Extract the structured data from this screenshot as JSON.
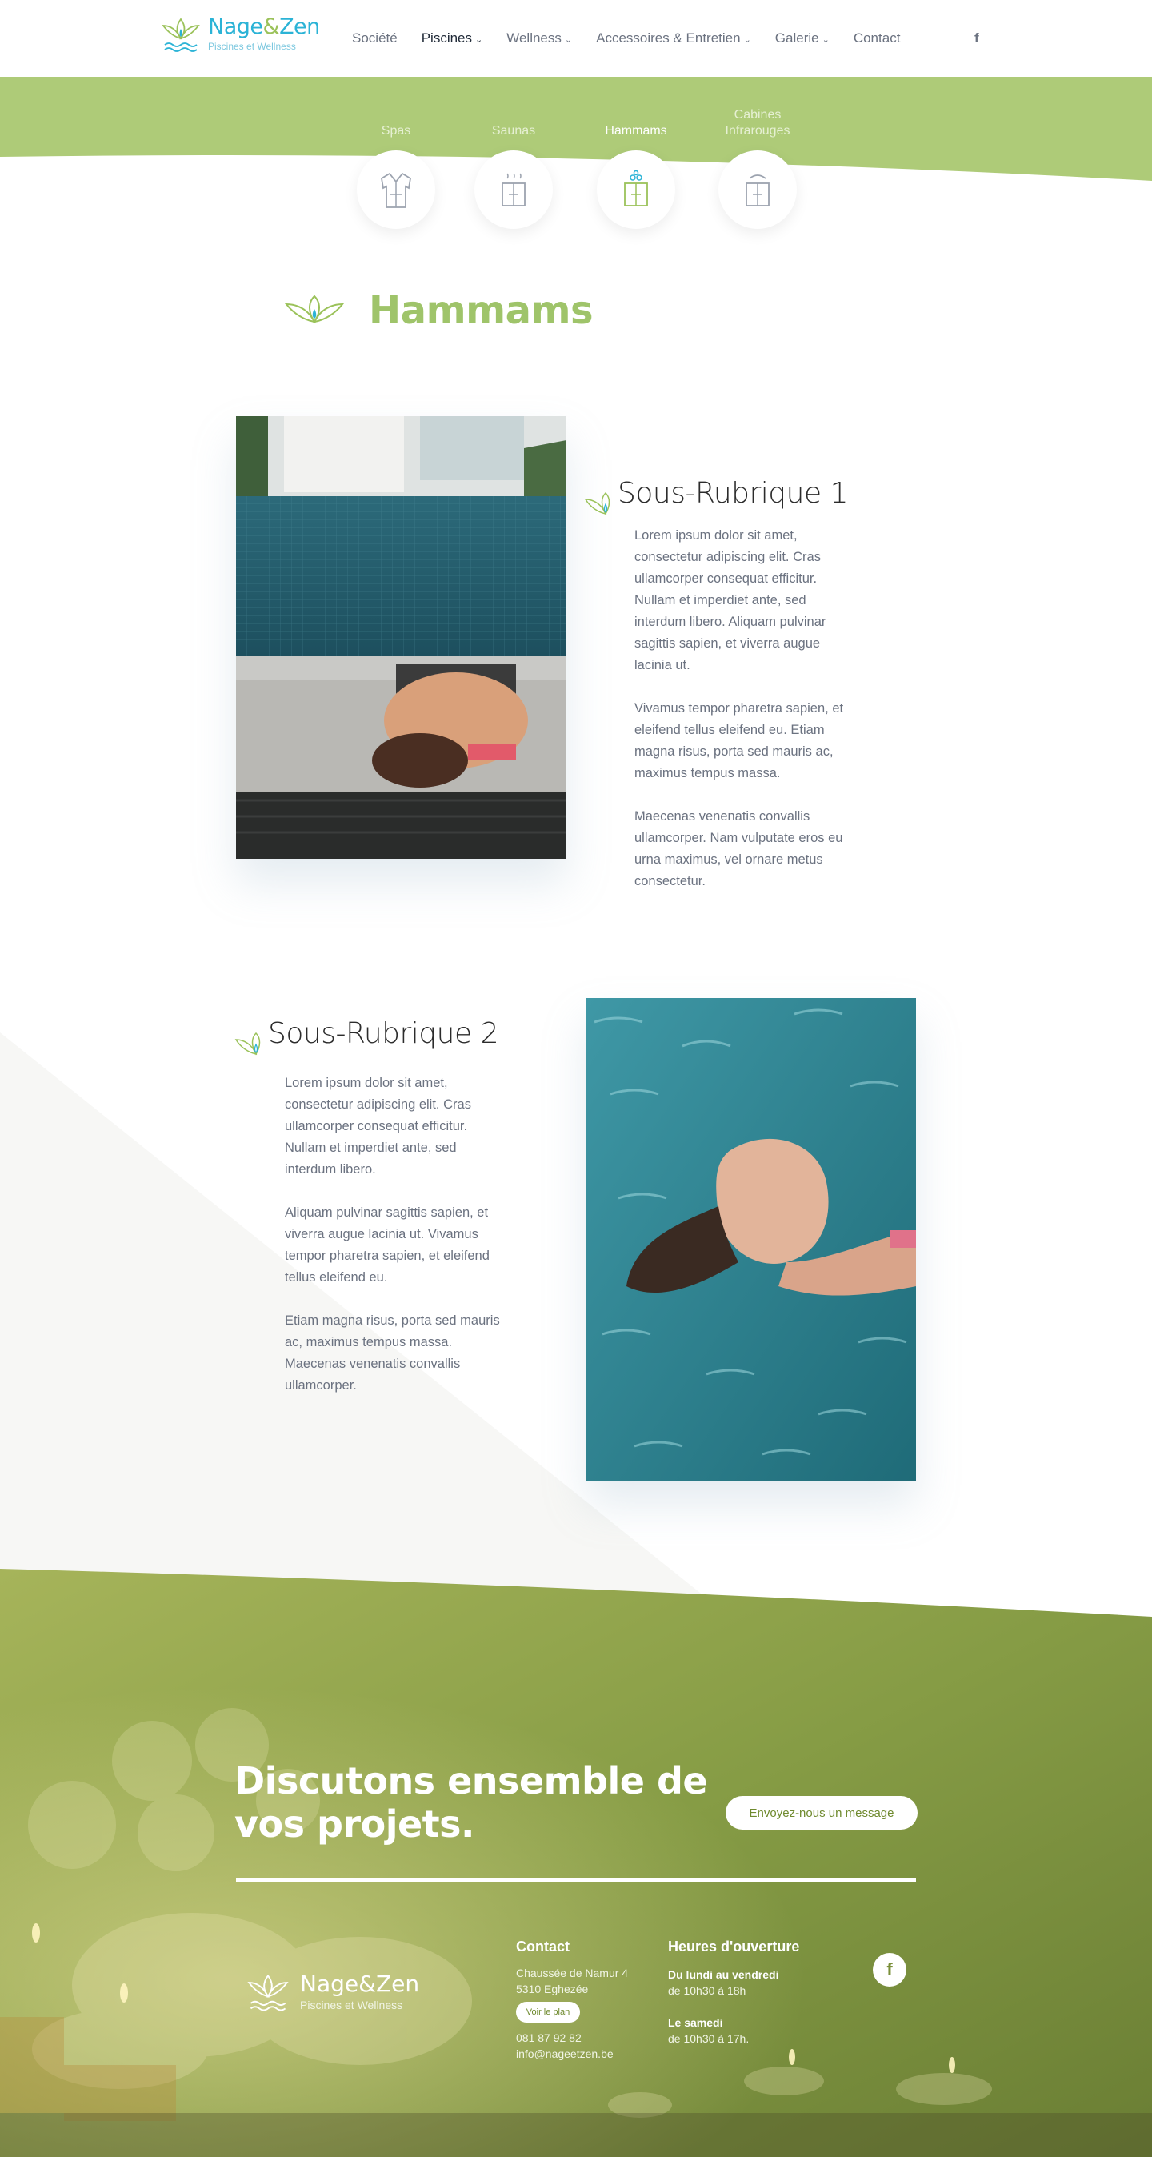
{
  "brand": {
    "name_part1": "Nage",
    "name_amp": "&",
    "name_part2": "Zen",
    "tagline": "Piscines et Wellness"
  },
  "nav": {
    "items": [
      {
        "label": "Société",
        "dropdown": false,
        "active": false
      },
      {
        "label": "Piscines",
        "dropdown": true,
        "active": true
      },
      {
        "label": "Wellness",
        "dropdown": true,
        "active": false
      },
      {
        "label": "Accessoires & Entretien",
        "dropdown": true,
        "active": false
      },
      {
        "label": "Galerie",
        "dropdown": true,
        "active": false
      },
      {
        "label": "Contact",
        "dropdown": false,
        "active": false
      }
    ],
    "social_icon": "facebook-icon"
  },
  "categories": [
    {
      "label": "Spas",
      "icon": "bathrobe-icon",
      "active": false
    },
    {
      "label": "Saunas",
      "icon": "sauna-icon",
      "active": false
    },
    {
      "label": "Hammams",
      "icon": "hammam-icon",
      "active": true
    },
    {
      "label": "Cabines Infrarouges",
      "icon": "infrared-cabin-icon",
      "active": false
    }
  ],
  "page": {
    "title": "Hammams"
  },
  "sections": [
    {
      "title": "Sous-Rubrique 1",
      "body": "Lorem ipsum dolor sit amet,\nconsectetur adipiscing elit. Cras\nullamcorper consequat efficitur.\nNullam et imperdiet ante, sed\ninterdum libero. Aliquam pulvinar\nsagittis sapien, et viverra augue\nlacinia ut.\n\nVivamus tempor pharetra sapien, et\neleifend tellus eleifend eu. Etiam\nmagna risus, porta sed mauris ac,\nmaximus tempus massa.\n\nMaecenas venenatis convallis\nullamcorper. Nam vulputate eros eu\nurna maximus, vel ornare metus\nconsectetur."
    },
    {
      "title": "Sous-Rubrique 2",
      "body": "Lorem ipsum dolor sit amet,\nconsectetur adipiscing elit. Cras\nullamcorper consequat efficitur.\nNullam et imperdiet ante, sed\ninterdum libero.\n\nAliquam pulvinar sagittis sapien, et\nviverra augue lacinia ut. Vivamus\ntempor pharetra sapien, et eleifend\ntellus eleifend eu.\n\nEtiam magna risus, porta sed mauris\nac, maximus tempus massa.\nMaecenas venenatis convallis\nullamcorper."
    }
  ],
  "footer": {
    "cta_title": "Discutons ensemble de vos projets.",
    "cta_button": "Envoyez-nous un message",
    "contact_title": "Contact",
    "address_line1": "Chaussée de Namur 4",
    "address_line2": "5310 Eghezée",
    "plan_button": "Voir le plan",
    "phone": "081 87 92 82",
    "email": "info@nageetzen.be",
    "hours_title": "Heures d'ouverture",
    "weekday_label": "Du lundi au vendredi",
    "weekday_hours": "de 10h30 à 18h",
    "saturday_label": "Le samedi",
    "saturday_hours": "de 10h30 à 17h."
  },
  "colors": {
    "brand_green": "#aecb78",
    "brand_blue": "#2bb3d6",
    "footer_green": "#7f9640"
  }
}
